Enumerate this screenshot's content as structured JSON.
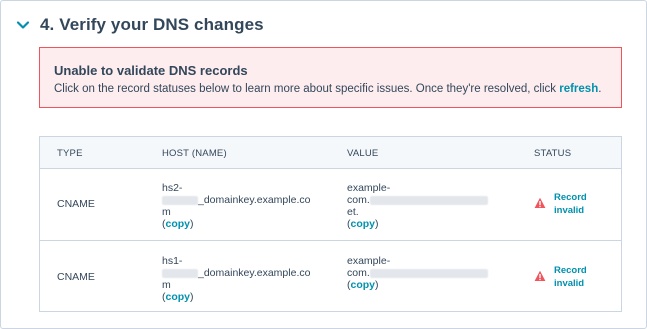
{
  "section": {
    "title": "4. Verify your DNS changes",
    "toggle_icon": "chevron-down-icon"
  },
  "alert": {
    "title": "Unable to validate DNS records",
    "text_before": "Click on the record statuses below to learn more about specific issues. Once they're resolved, click ",
    "link": "refresh",
    "text_after": "."
  },
  "table": {
    "headers": {
      "type": "TYPE",
      "host": "HOST (NAME)",
      "value": "VALUE",
      "status": "STATUS"
    },
    "rows": [
      {
        "type": "CNAME",
        "host_line1": "hs2-",
        "host_line2": "_domainkey.example.co",
        "host_line3": "m",
        "value_line1": "example-",
        "value_line2": "com.",
        "value_line3": "et.",
        "copy_label": "copy",
        "status_line1": "Record",
        "status_line2": "invalid"
      },
      {
        "type": "CNAME",
        "host_line1": "hs1-",
        "host_line2": "_domainkey.example.co",
        "host_line3": "m",
        "value_line1": "example-",
        "value_line2": "com.",
        "value_line3": "",
        "copy_label": "copy",
        "status_line1": "Record",
        "status_line2": "invalid"
      }
    ]
  },
  "colors": {
    "text": "#33475b",
    "link": "#0091ae",
    "alert_bg": "#fdedee",
    "alert_border": "#f2545b",
    "warning": "#f2545b"
  }
}
